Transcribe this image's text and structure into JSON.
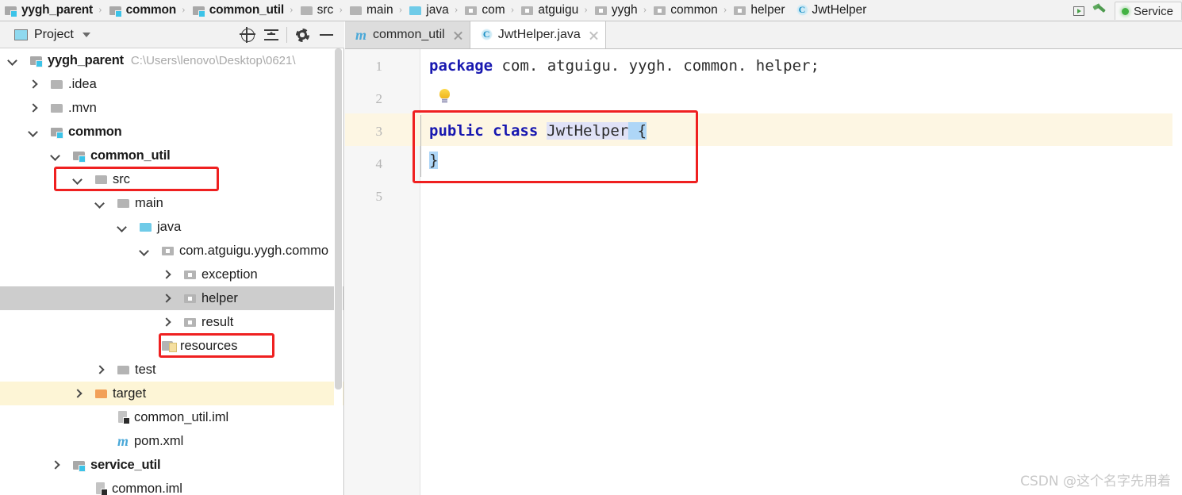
{
  "navbar": {
    "crumbs": [
      {
        "label": "yygh_parent",
        "icon": "module-icon",
        "bold": true
      },
      {
        "label": "common",
        "icon": "module-icon",
        "bold": true
      },
      {
        "label": "common_util",
        "icon": "module-icon",
        "bold": true
      },
      {
        "label": "src",
        "icon": "folder-icon",
        "bold": false
      },
      {
        "label": "main",
        "icon": "folder-icon",
        "bold": false
      },
      {
        "label": "java",
        "icon": "source-folder-icon",
        "bold": false
      },
      {
        "label": "com",
        "icon": "package-icon",
        "bold": false
      },
      {
        "label": "atguigu",
        "icon": "package-icon",
        "bold": false
      },
      {
        "label": "yygh",
        "icon": "package-icon",
        "bold": false
      },
      {
        "label": "common",
        "icon": "package-icon",
        "bold": false
      },
      {
        "label": "helper",
        "icon": "package-icon",
        "bold": false
      },
      {
        "label": "JwtHelper",
        "icon": "java-class-icon",
        "bold": false
      }
    ],
    "separator": "›",
    "run_button": "run-icon",
    "build_button": "hammer-icon",
    "services_tab": "Service"
  },
  "project_panel": {
    "title": "Project",
    "title_icon": "project-view-icon",
    "dropdown_icon": "chevron-down-icon",
    "actions": [
      {
        "name": "locate-icon"
      },
      {
        "name": "collapse-all-icon"
      },
      {
        "name": "settings-gear-icon"
      },
      {
        "name": "hide-panel-icon"
      }
    ],
    "tree": [
      {
        "label": "yygh_parent",
        "path": "C:\\Users\\lenovo\\Desktop\\0621\\",
        "icon": "module-icon",
        "arrow": "down",
        "indent": 0,
        "bold": true,
        "state": "none"
      },
      {
        "label": ".idea",
        "icon": "folder-icon",
        "arrow": "right",
        "indent": 1,
        "bold": false,
        "state": "none"
      },
      {
        "label": ".mvn",
        "icon": "folder-icon",
        "arrow": "right",
        "indent": 1,
        "bold": false,
        "state": "none"
      },
      {
        "label": "common",
        "icon": "module-icon",
        "arrow": "down",
        "indent": 1,
        "bold": true,
        "state": "none"
      },
      {
        "label": "common_util",
        "icon": "module-icon",
        "arrow": "down",
        "indent": 2,
        "bold": true,
        "state": "boxed"
      },
      {
        "label": "src",
        "icon": "folder-icon",
        "arrow": "down",
        "indent": 3,
        "bold": false,
        "state": "none"
      },
      {
        "label": "main",
        "icon": "folder-icon",
        "arrow": "down",
        "indent": 4,
        "bold": false,
        "state": "none"
      },
      {
        "label": "java",
        "icon": "source-folder-icon",
        "arrow": "down",
        "indent": 5,
        "bold": false,
        "state": "none"
      },
      {
        "label": "com.atguigu.yygh.commo",
        "icon": "package-icon",
        "arrow": "down",
        "indent": 6,
        "bold": false,
        "state": "none"
      },
      {
        "label": "exception",
        "icon": "package-icon",
        "arrow": "right",
        "indent": 7,
        "bold": false,
        "state": "none"
      },
      {
        "label": "helper",
        "icon": "package-icon",
        "arrow": "right",
        "indent": 7,
        "bold": false,
        "state": "selected-boxed"
      },
      {
        "label": "result",
        "icon": "package-icon",
        "arrow": "right",
        "indent": 7,
        "bold": false,
        "state": "none"
      },
      {
        "label": "resources",
        "icon": "resources-folder-icon",
        "arrow": "none",
        "indent": 6,
        "bold": false,
        "state": "none"
      },
      {
        "label": "test",
        "icon": "folder-icon",
        "arrow": "right",
        "indent": 4,
        "bold": false,
        "state": "none"
      },
      {
        "label": "target",
        "icon": "excluded-folder-icon",
        "arrow": "right",
        "indent": 3,
        "bold": false,
        "state": "highlighted"
      },
      {
        "label": "common_util.iml",
        "icon": "iml-file-icon",
        "arrow": "none",
        "indent": 4,
        "bold": false,
        "state": "none"
      },
      {
        "label": "pom.xml",
        "icon": "maven-file-icon",
        "arrow": "none",
        "indent": 4,
        "bold": false,
        "state": "none"
      },
      {
        "label": "service_util",
        "icon": "module-icon",
        "arrow": "right",
        "indent": 2,
        "bold": true,
        "state": "none"
      },
      {
        "label": "common.iml",
        "icon": "iml-file-icon",
        "arrow": "none",
        "indent": 3,
        "bold": false,
        "state": "none"
      }
    ]
  },
  "editor": {
    "tabs": [
      {
        "label": "common_util",
        "icon": "maven-file-icon",
        "active": false
      },
      {
        "label": "JwtHelper.java",
        "icon": "java-class-icon",
        "active": true
      }
    ],
    "line_numbers": [
      "1",
      "2",
      "3",
      "4",
      "5"
    ],
    "highlighted_line": "3",
    "intention_icon": "lightbulb-icon",
    "code": {
      "line1_kw": "package",
      "line1_rest": " com. atguigu. yygh. common. helper;",
      "line3_kw": "public class",
      "line3_class": "JwtHelper",
      "line3_brace": " {",
      "line4_brace": "}"
    }
  },
  "watermark": "CSDN @这个名字先用着",
  "colors": {
    "annotation_red": "#ef2020",
    "keyword_blue": "#1818b0",
    "selection_blue": "#aed6f7",
    "line_highlight": "#fdf6e3",
    "tree_selection": "#cdcdcd"
  }
}
